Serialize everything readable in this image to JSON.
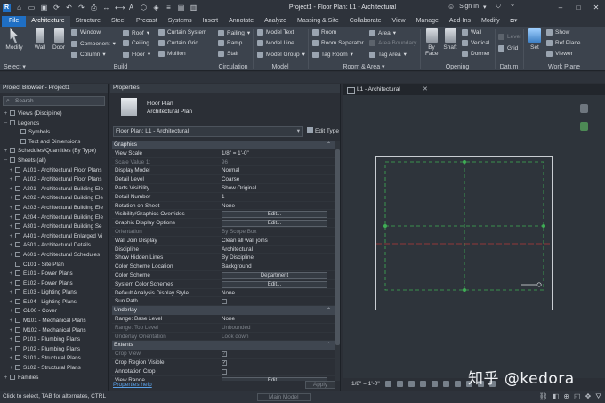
{
  "window": {
    "title": "Project1 - Floor Plan: L1 - Architectural",
    "signin": "Sign In"
  },
  "tabs": [
    "File",
    "Architecture",
    "Structure",
    "Steel",
    "Precast",
    "Systems",
    "Insert",
    "Annotate",
    "Analyze",
    "Massing & Site",
    "Collaborate",
    "View",
    "Manage",
    "Add-Ins",
    "Modify"
  ],
  "ribbon": {
    "select": {
      "modify": "Modify",
      "label": "Select ▾"
    },
    "build": {
      "label": "Build",
      "wall": "Wall",
      "door": "Door",
      "window": "Window",
      "component": "Component",
      "column": "Column",
      "roof": "Roof",
      "ceiling": "Ceiling",
      "floor": "Floor",
      "curtain_system": "Curtain System",
      "curtain_grid": "Curtain Grid",
      "mullion": "Mullion"
    },
    "circulation": {
      "label": "Circulation",
      "railing": "Railing",
      "ramp": "Ramp",
      "stair": "Stair"
    },
    "model": {
      "label": "Model",
      "model_text": "Model Text",
      "model_line": "Model Line",
      "model_group": "Model Group"
    },
    "room_area": {
      "label": "Room & Area ▾",
      "room": "Room",
      "room_separator": "Room Separator",
      "tag_room": "Tag Room",
      "area": "Area",
      "area_boundary": "Area Boundary",
      "tag_area": "Tag Area"
    },
    "opening": {
      "label": "Opening",
      "by_face": "By Face",
      "shaft": "Shaft",
      "wall": "Wall",
      "vertical": "Vertical",
      "dormer": "Dormer"
    },
    "datum": {
      "label": "Datum",
      "level": "Level",
      "grid": "Grid"
    },
    "work_plane": {
      "label": "Work Plane",
      "set": "Set",
      "show": "Show",
      "ref_plane": "Ref Plane",
      "viewer": "Viewer"
    }
  },
  "project_browser": {
    "title": "Project Browser - Project1",
    "search_placeholder": "Search",
    "items": [
      {
        "exp": "+",
        "label": "Views (Discipline)",
        "indent": 0
      },
      {
        "exp": "−",
        "label": "Legends",
        "indent": 0
      },
      {
        "exp": "",
        "label": "Symbols",
        "indent": 2
      },
      {
        "exp": "",
        "label": "Text and Dimensions",
        "indent": 2
      },
      {
        "exp": "+",
        "label": "Schedules/Quantities (By Type)",
        "indent": 0
      },
      {
        "exp": "−",
        "label": "Sheets (all)",
        "indent": 0
      },
      {
        "exp": "+",
        "label": "A101 - Architectural Floor Plans",
        "indent": 1
      },
      {
        "exp": "+",
        "label": "A102 - Architectural Floor Plans",
        "indent": 1
      },
      {
        "exp": "+",
        "label": "A201 - Architectural Building Ele",
        "indent": 1
      },
      {
        "exp": "+",
        "label": "A202 - Architectural Building Ele",
        "indent": 1
      },
      {
        "exp": "+",
        "label": "A203 - Architectural Building Ele",
        "indent": 1
      },
      {
        "exp": "+",
        "label": "A204 - Architectural Building Ele",
        "indent": 1
      },
      {
        "exp": "+",
        "label": "A301 - Architectural Building Se",
        "indent": 1
      },
      {
        "exp": "+",
        "label": "A401 - Architectural Enlarged Vi",
        "indent": 1
      },
      {
        "exp": "+",
        "label": "A501 - Architectural Details",
        "indent": 1
      },
      {
        "exp": "+",
        "label": "A601 - Architectural Schedules",
        "indent": 1
      },
      {
        "exp": "",
        "label": "C101 - Site Plan",
        "indent": 1
      },
      {
        "exp": "+",
        "label": "E101 - Power Plans",
        "indent": 1
      },
      {
        "exp": "+",
        "label": "E102 - Power Plans",
        "indent": 1
      },
      {
        "exp": "+",
        "label": "E103 - Lighting Plans",
        "indent": 1
      },
      {
        "exp": "+",
        "label": "E104 - Lighting Plans",
        "indent": 1
      },
      {
        "exp": "+",
        "label": "G100 - Cover",
        "indent": 1
      },
      {
        "exp": "+",
        "label": "M101 - Mechanical Plans",
        "indent": 1
      },
      {
        "exp": "+",
        "label": "M102 - Mechanical Plans",
        "indent": 1
      },
      {
        "exp": "+",
        "label": "P101 - Plumbing Plans",
        "indent": 1
      },
      {
        "exp": "+",
        "label": "P102 - Plumbing Plans",
        "indent": 1
      },
      {
        "exp": "+",
        "label": "S101 - Structural Plans",
        "indent": 1
      },
      {
        "exp": "+",
        "label": "S102 - Structural Plans",
        "indent": 1
      },
      {
        "exp": "+",
        "label": "Families",
        "indent": 0
      }
    ]
  },
  "properties": {
    "title": "Properties",
    "type_name_1": "Floor Plan",
    "type_name_2": "Architectural Plan",
    "selector": "Floor Plan: L1 - Architectural",
    "edit_type": "Edit Type",
    "help_link": "Properties help",
    "apply": "Apply",
    "sections": [
      {
        "name": "Graphics",
        "rows": [
          {
            "n": "View Scale",
            "v": "1/8\" = 1'-0\"",
            "k": "text"
          },
          {
            "n": "Scale Value    1:",
            "v": "96",
            "k": "dis"
          },
          {
            "n": "Display Model",
            "v": "Normal",
            "k": "text"
          },
          {
            "n": "Detail Level",
            "v": "Coarse",
            "k": "text"
          },
          {
            "n": "Parts Visibility",
            "v": "Show Original",
            "k": "text"
          },
          {
            "n": "Detail Number",
            "v": "1",
            "k": "text"
          },
          {
            "n": "Rotation on Sheet",
            "v": "None",
            "k": "text"
          },
          {
            "n": "Visibility/Graphics Overrides",
            "v": "Edit...",
            "k": "btn"
          },
          {
            "n": "Graphic Display Options",
            "v": "Edit...",
            "k": "btn"
          },
          {
            "n": "Orientation",
            "v": "By Scope Box",
            "k": "dis"
          },
          {
            "n": "Wall Join Display",
            "v": "Clean all wall joins",
            "k": "text"
          },
          {
            "n": "Discipline",
            "v": "Architectural",
            "k": "text"
          },
          {
            "n": "Show Hidden Lines",
            "v": "By Discipline",
            "k": "text"
          },
          {
            "n": "Color Scheme Location",
            "v": "Background",
            "k": "text"
          },
          {
            "n": "Color Scheme",
            "v": "Department",
            "k": "btn"
          },
          {
            "n": "System Color Schemes",
            "v": "Edit...",
            "k": "btn"
          },
          {
            "n": "Default Analysis Display Style",
            "v": "None",
            "k": "text"
          },
          {
            "n": "Sun Path",
            "v": "",
            "k": "chk"
          }
        ]
      },
      {
        "name": "Underlay",
        "rows": [
          {
            "n": "Range: Base Level",
            "v": "None",
            "k": "text"
          },
          {
            "n": "Range: Top Level",
            "v": "Unbounded",
            "k": "dis"
          },
          {
            "n": "Underlay Orientation",
            "v": "Look down",
            "k": "dis"
          }
        ]
      },
      {
        "name": "Extents",
        "rows": [
          {
            "n": "Crop View",
            "v": "✓",
            "k": "chkdis"
          },
          {
            "n": "Crop Region Visible",
            "v": "✓",
            "k": "chk"
          },
          {
            "n": "Annotation Crop",
            "v": "",
            "k": "chk"
          },
          {
            "n": "View Range",
            "v": "Edit...",
            "k": "btn"
          }
        ]
      }
    ]
  },
  "view": {
    "tab": "L1 - Architectural",
    "scale": "1/8\" = 1'-0\""
  },
  "status": {
    "hint": "Click to select, TAB for alternates, CTRL",
    "model": "Main Model"
  },
  "watermark": "知乎 @kedora"
}
